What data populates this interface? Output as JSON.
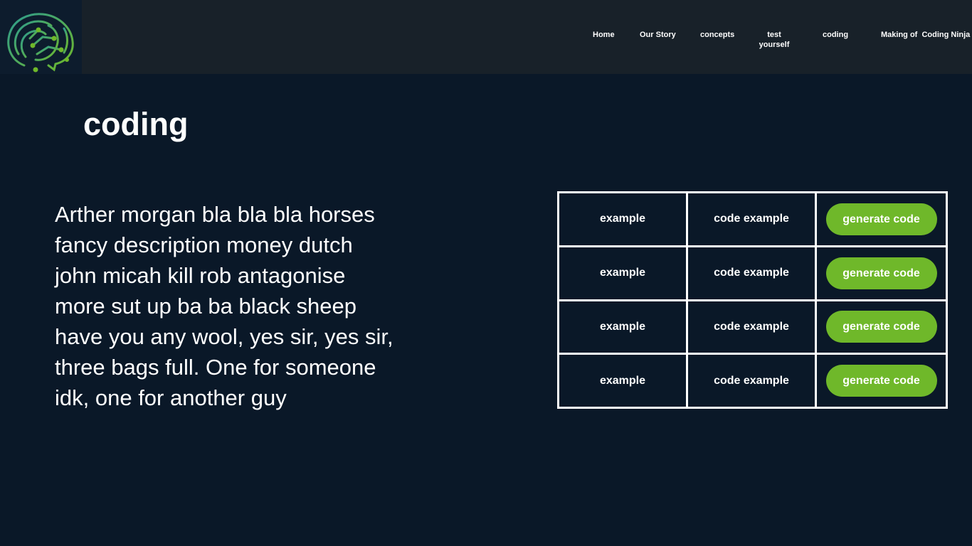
{
  "header": {
    "logo": {
      "icon": "circuit-brain-logo-icon",
      "colors": [
        "#2e9c8e",
        "#6fb82a",
        "#3aa5b0"
      ]
    },
    "nav": [
      {
        "label": "Home"
      },
      {
        "label": "Our Story"
      },
      {
        "label": "concepts"
      },
      {
        "label": "test yourself"
      },
      {
        "label": "coding"
      },
      {
        "label": "Making of  Coding Ninja"
      }
    ]
  },
  "main": {
    "title": "coding",
    "description": "Arther morgan bla bla bla horses fancy description money dutch john micah kill rob antagonise more sut up ba ba black sheep have you any wool, yes sir, yes sir, three bags full. One for someone idk, one for another guy"
  },
  "table": {
    "rows": [
      {
        "example": "example",
        "code": "code example",
        "button": "generate code"
      },
      {
        "example": "example",
        "code": "code example",
        "button": "generate code"
      },
      {
        "example": "example",
        "code": "code example",
        "button": "generate code"
      },
      {
        "example": "example",
        "code": "code example",
        "button": "generate code"
      }
    ]
  },
  "colors": {
    "background": "#0a1828",
    "header": "#182129",
    "button": "#6fb82a",
    "text": "#ffffff"
  }
}
